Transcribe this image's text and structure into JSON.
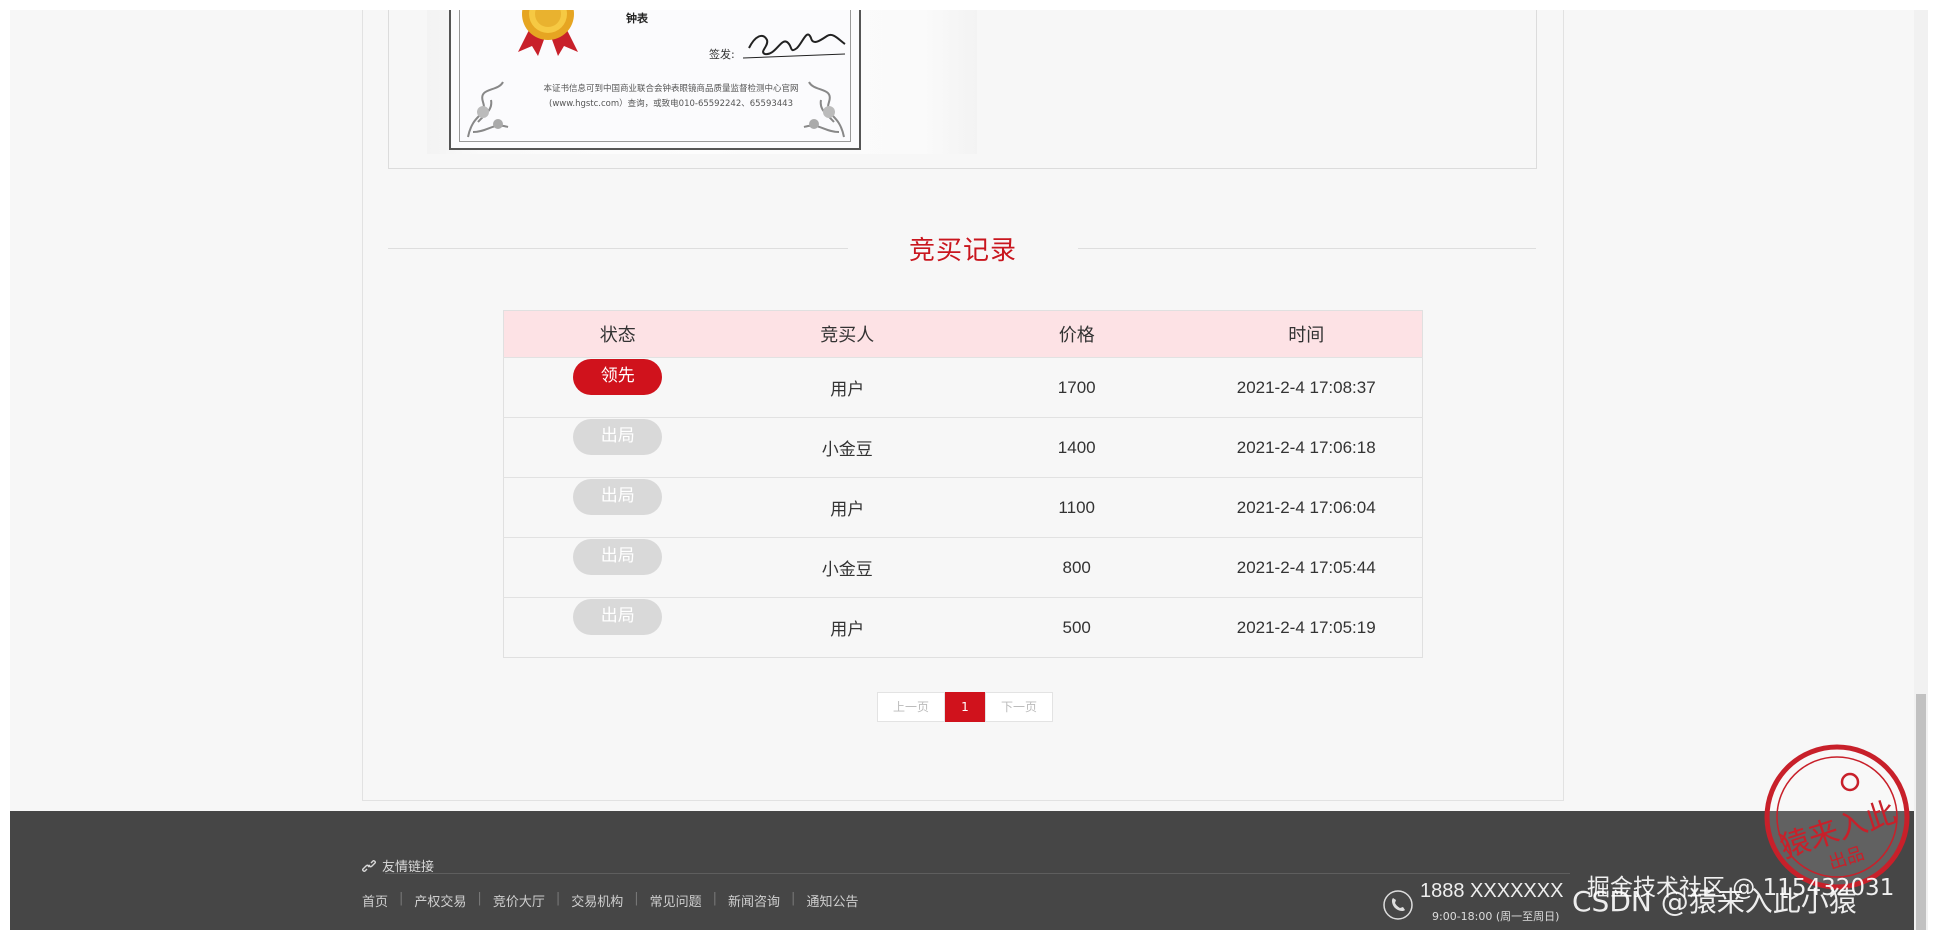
{
  "certificate": {
    "title": "钟表",
    "sign_label": "签发:",
    "note_line1": "本证书信息可到中国商业联合会钟表眼镜商品质量监督检测中心官网",
    "note_line2": "(www.hgstc.com）查询，或致电010-65592242、65593443"
  },
  "section": {
    "title": "竞买记录"
  },
  "table": {
    "headers": [
      "状态",
      "竞买人",
      "价格",
      "时间"
    ],
    "rows": [
      {
        "status": "领先",
        "status_type": "lead",
        "bidder": "用户",
        "price": "1700",
        "time": "2021-2-4 17:08:37"
      },
      {
        "status": "出局",
        "status_type": "out",
        "bidder": "小金豆",
        "price": "1400",
        "time": "2021-2-4 17:06:18"
      },
      {
        "status": "出局",
        "status_type": "out",
        "bidder": "用户",
        "price": "1100",
        "time": "2021-2-4 17:06:04"
      },
      {
        "status": "出局",
        "status_type": "out",
        "bidder": "小金豆",
        "price": "800",
        "time": "2021-2-4 17:05:44"
      },
      {
        "status": "出局",
        "status_type": "out",
        "bidder": "用户",
        "price": "500",
        "time": "2021-2-4 17:05:19"
      }
    ]
  },
  "pagination": {
    "prev": "上一页",
    "current": "1",
    "next": "下一页"
  },
  "footer": {
    "links_title": "友情链接",
    "nav": [
      "首页",
      "产权交易",
      "竞价大厅",
      "交易机构",
      "常见问题",
      "新闻咨询",
      "通知公告"
    ],
    "phone": "1888 XXXXXXX",
    "hours": "9:00-18:00 (周一至周日)"
  },
  "watermark": {
    "line1": "掘金技术社区 @ 115432031",
    "line2": "CSDN @猿来入此小猿",
    "stamp_text": "猿来入此",
    "stamp_sub": "出品"
  },
  "colors": {
    "accent": "#d0121c",
    "header_bg": "#fde2e5",
    "footer_bg": "#464646",
    "out_badge": "#d9d9d9"
  }
}
